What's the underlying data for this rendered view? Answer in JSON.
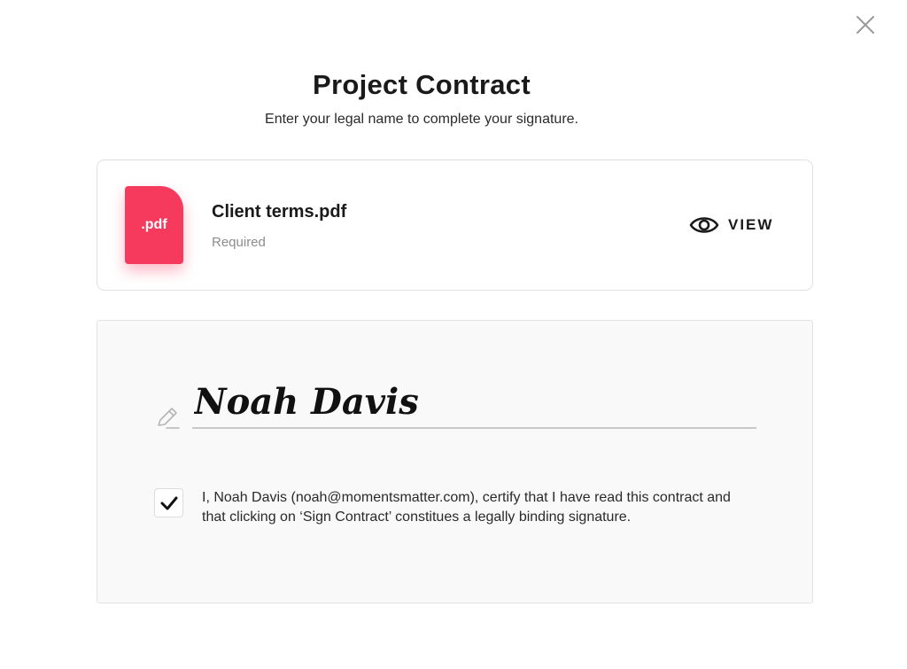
{
  "dialog": {
    "title": "Project Contract",
    "subtitle": "Enter your legal name to complete your signature.",
    "close_icon": "close-icon"
  },
  "document": {
    "file_badge": ".pdf",
    "name": "Client terms.pdf",
    "status": "Required",
    "view_label": "VIEW",
    "view_icon": "eye-icon",
    "badge_color": "#f63a5e"
  },
  "signature": {
    "value": "Noah Davis",
    "pen_icon": "pen-icon"
  },
  "consent": {
    "checked": true,
    "text": "I, Noah Davis (noah@momentsmatter.com), certify that I have read this contract and that clicking on ‘Sign Contract’ constitues a legally binding signature."
  }
}
